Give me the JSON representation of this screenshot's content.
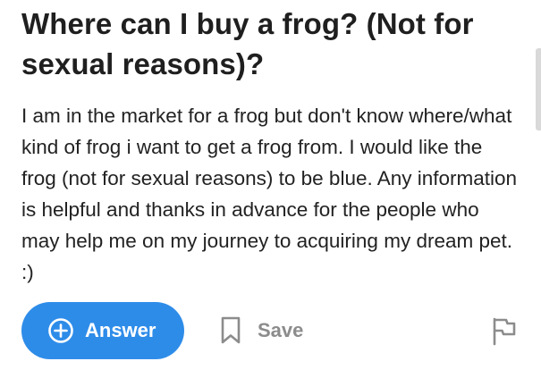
{
  "question": {
    "title": "Where can I buy a frog? (Not for sexual reasons)?",
    "body": "I am in the market for a frog but don't know where/what kind of frog i want to get a frog from. I would like the frog (not for sexual reasons) to be blue. Any information is helpful and thanks in advance for the people who may help me on my journey to acquiring my dream pet. :)"
  },
  "actions": {
    "answer_label": "Answer",
    "answer_icon": "plus-circle-icon",
    "save_label": "Save",
    "save_icon": "bookmark-icon",
    "report_icon": "flag-icon"
  },
  "colors": {
    "accent": "#2e8ce9",
    "title_text": "#1f1f1f",
    "body_text": "#222222",
    "muted_action": "#8c8c8c"
  }
}
